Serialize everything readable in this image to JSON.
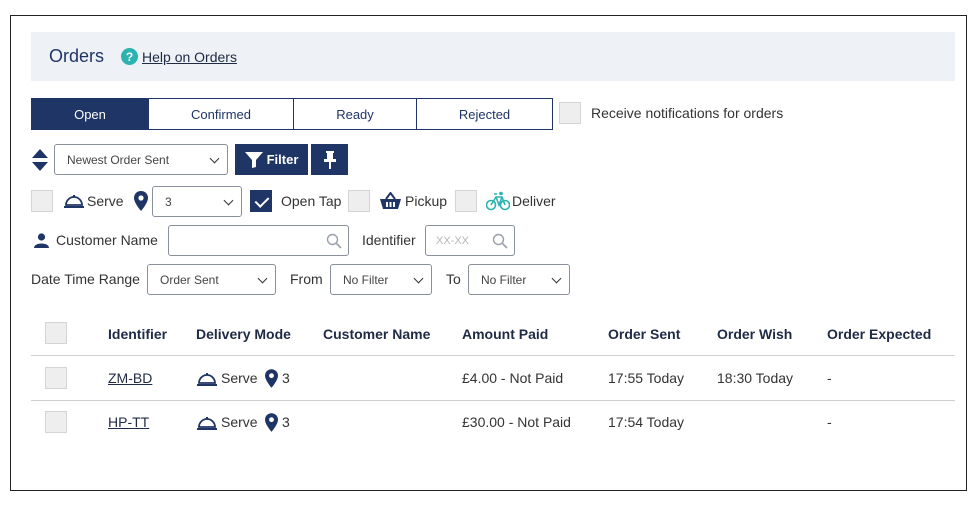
{
  "header": {
    "title": "Orders",
    "help_label": "Help on Orders"
  },
  "tabs": [
    {
      "label": "Open",
      "active": true
    },
    {
      "label": "Confirmed",
      "active": false
    },
    {
      "label": "Ready",
      "active": false
    },
    {
      "label": "Rejected",
      "active": false
    }
  ],
  "notifications": {
    "label": "Receive notifications for orders",
    "checked": false
  },
  "sort": {
    "selected": "Newest Order Sent",
    "filter_label": "Filter"
  },
  "delivery_modes": {
    "serve_label": "Serve",
    "table_selected": "3",
    "open_tab_label": "Open Tap",
    "open_tab_checked": true,
    "pickup_label": "Pickup",
    "deliver_label": "Deliver"
  },
  "search": {
    "customer_name_label": "Customer Name",
    "customer_name_value": "",
    "identifier_label": "Identifier",
    "identifier_placeholder": "XX-XX"
  },
  "date_range": {
    "label": "Date Time Range",
    "type_selected": "Order Sent",
    "from_label": "From",
    "from_selected": "No Filter",
    "to_label": "To",
    "to_selected": "No Filter"
  },
  "table": {
    "headers": [
      "Identifier",
      "Delivery Mode",
      "Customer Name",
      "Amount Paid",
      "Order Sent",
      "Order Wish",
      "Order Expected"
    ],
    "rows": [
      {
        "identifier": "ZM-BD",
        "mode": "Serve",
        "table": "3",
        "customer": "",
        "amount": "£4.00 - Not Paid",
        "sent": "17:55 Today",
        "wish": "18:30 Today",
        "expected": "-"
      },
      {
        "identifier": "HP-TT",
        "mode": "Serve",
        "table": "3",
        "customer": "",
        "amount": "£30.00 - Not Paid",
        "sent": "17:54 Today",
        "wish": "",
        "expected": "-"
      }
    ]
  },
  "colors": {
    "primary": "#1f3566",
    "help": "#2bb3b0",
    "header_bg": "#eef1f5"
  },
  "icons": [
    "help-icon",
    "sort-icon",
    "filter-icon",
    "pin-icon",
    "serve-icon",
    "location-icon",
    "pickup-basket-icon",
    "bicycle-icon",
    "user-icon",
    "search-icon"
  ]
}
